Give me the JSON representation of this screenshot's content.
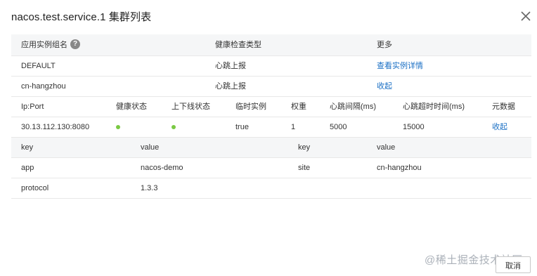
{
  "dialog": {
    "title": "nacos.test.service.1 集群列表",
    "close_icon": "close-icon"
  },
  "cluster_table": {
    "headers": [
      "应用实例组名",
      "健康检查类型",
      "更多"
    ],
    "help_icon": "question-icon",
    "rows": [
      {
        "name": "DEFAULT",
        "check_type": "心跳上报",
        "action": "查看实例详情"
      },
      {
        "name": "cn-hangzhou",
        "check_type": "心跳上报",
        "action": "收起"
      }
    ]
  },
  "instance_table": {
    "headers": [
      "Ip:Port",
      "健康状态",
      "上下线状态",
      "临时实例",
      "权重",
      "心跳间隔(ms)",
      "心跳超时时间(ms)",
      "元数据"
    ],
    "rows": [
      {
        "ip_port": "30.13.112.130:8080",
        "healthy_color": "#7ac943",
        "online_color": "#7ac943",
        "ephemeral": "true",
        "weight": "1",
        "heartbeat_interval": "5000",
        "heartbeat_timeout": "15000",
        "metadata_action": "收起"
      }
    ]
  },
  "metadata_table": {
    "headers": [
      "key",
      "value",
      "key",
      "value"
    ],
    "rows": [
      [
        "app",
        "nacos-demo",
        "site",
        "cn-hangzhou"
      ],
      [
        "protocol",
        "1.3.3",
        "",
        ""
      ]
    ]
  },
  "footer": {
    "watermark": "@稀土掘金技术社区",
    "cancel_label": "取消"
  },
  "colors": {
    "link": "#1a6fc4",
    "status_green": "#7ac943"
  }
}
